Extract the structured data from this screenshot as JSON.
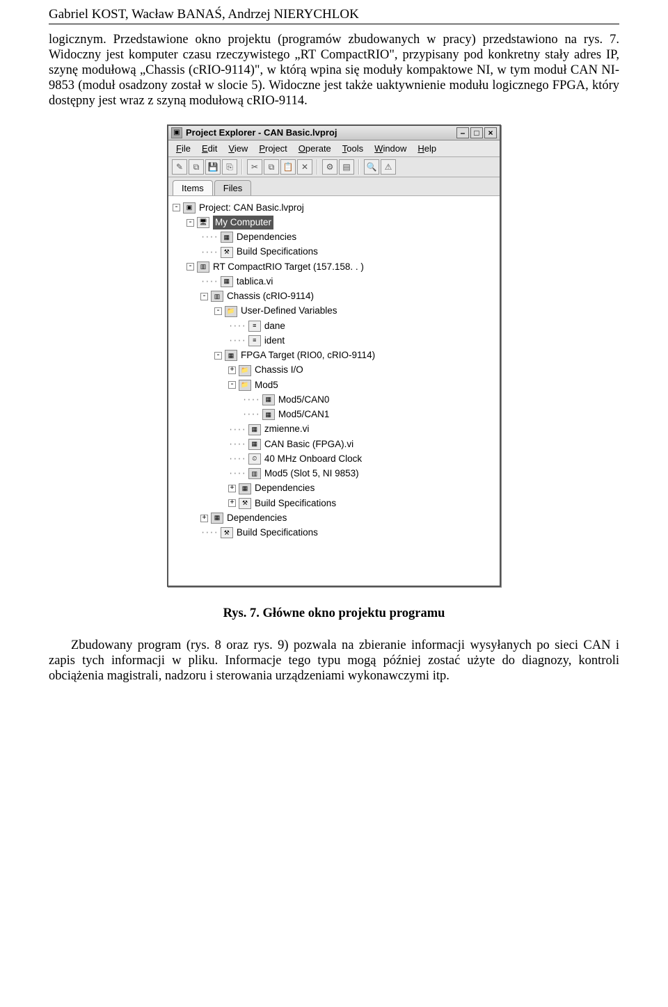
{
  "header": {
    "authors": "Gabriel KOST, Wacław BANAŚ, Andrzej NIERYCHLOK"
  },
  "para1": "logicznym. Przedstawione okno projektu (programów zbudowanych w pracy) przedstawiono na rys. 7. Widoczny jest komputer czasu rzeczywistego „RT CompactRIO\", przypisany pod konkretny stały adres IP, szynę modułową „Chassis (cRIO-9114)\", w którą wpina się moduły kompaktowe NI, w tym moduł CAN NI-9853 (moduł osadzony został w slocie 5). Widoczne jest także uaktywnienie modułu logicznego FPGA, który dostępny jest wraz z szyną modułową cRIO-9114.",
  "window": {
    "title": "Project Explorer - CAN Basic.lvproj",
    "menus": [
      "File",
      "Edit",
      "View",
      "Project",
      "Operate",
      "Tools",
      "Window",
      "Help"
    ],
    "tabs": {
      "items": "Items",
      "files": "Files"
    },
    "tree": {
      "project": "Project: CAN Basic.lvproj",
      "mycomputer": "My Computer",
      "deps1": "Dependencies",
      "build1": "Build Specifications",
      "rt": "RT CompactRIO Target (157.158.   .   )",
      "tablica": "tablica.vi",
      "chassis": "Chassis (cRIO-9114)",
      "udv": "User-Defined Variables",
      "dane": "dane",
      "ident": "ident",
      "fpga": "FPGA Target (RIO0, cRIO-9114)",
      "chassisio": "Chassis I/O",
      "mod5": "Mod5",
      "mod5can0": "Mod5/CAN0",
      "mod5can1": "Mod5/CAN1",
      "zmienne": "zmienne.vi",
      "canbasic": "CAN Basic (FPGA).vi",
      "clock": "40 MHz Onboard Clock",
      "mod5slot": "Mod5 (Slot 5, NI 9853)",
      "deps2": "Dependencies",
      "build2": "Build Specifications",
      "deps3": "Dependencies",
      "build3": "Build Specifications"
    }
  },
  "caption": "Rys. 7. Główne okno projektu programu",
  "para2": "Zbudowany program (rys. 8 oraz rys. 9) pozwala na zbieranie informacji wysyłanych po sieci CAN i zapis tych informacji w pliku. Informacje tego typu mogą później zostać użyte do diagnozy, kontroli obciążenia magistrali, nadzoru i sterowania urządzeniami wykonawczymi itp."
}
